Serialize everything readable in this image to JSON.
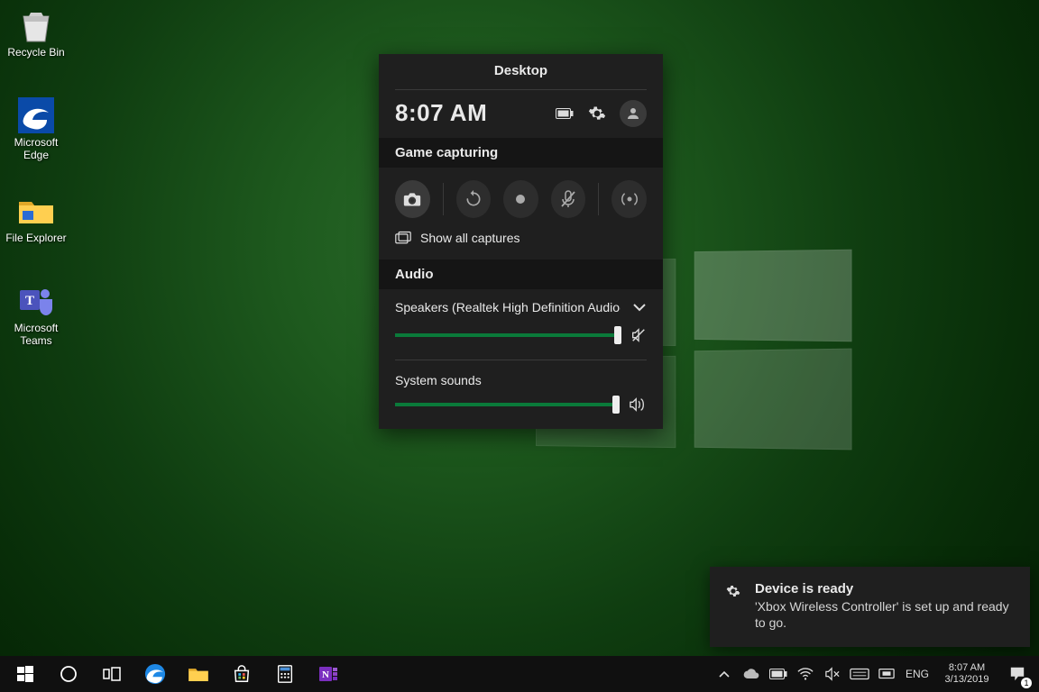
{
  "desktop_icons": {
    "recycle_bin": "Recycle Bin",
    "edge": "Microsoft Edge",
    "file_explorer": "File Explorer",
    "teams": "Microsoft Teams"
  },
  "gamebar": {
    "title": "Desktop",
    "time": "8:07 AM",
    "sections": {
      "capture": "Game capturing",
      "audio": "Audio"
    },
    "show_all": "Show all captures",
    "audio_device": "Speakers (Realtek High Definition Audio(SS",
    "system_sounds": "System sounds",
    "volume_main_pct": 100,
    "volume_system_pct": 100
  },
  "toast": {
    "title": "Device is ready",
    "body": "'Xbox Wireless Controller' is set up and ready to go."
  },
  "tray": {
    "lang": "ENG",
    "time": "8:07 AM",
    "date": "3/13/2019",
    "notif_count": "1"
  }
}
